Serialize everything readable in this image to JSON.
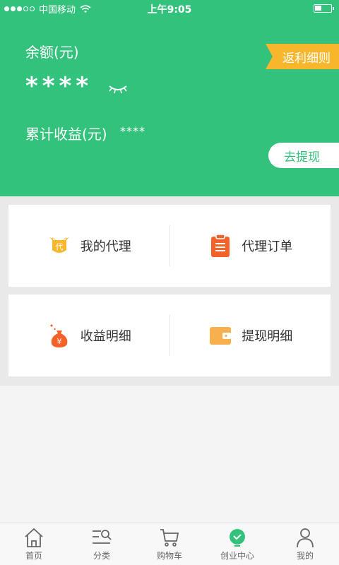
{
  "status_bar": {
    "carrier": "中国移动",
    "time": "上午9:05"
  },
  "header": {
    "balance_label": "余额(元)",
    "balance_value": "****",
    "income_label": "累计收益(元)",
    "income_value": "****",
    "rebate_tag": "返利细则",
    "withdraw_button": "去提现"
  },
  "menu": {
    "my_agent": "我的代理",
    "agent_orders": "代理订单",
    "income_detail": "收益明细",
    "withdraw_detail": "提现明细"
  },
  "tabs": [
    {
      "label": "首页",
      "icon": "home-icon"
    },
    {
      "label": "分类",
      "icon": "category-icon"
    },
    {
      "label": "购物车",
      "icon": "cart-icon"
    },
    {
      "label": "创业中心",
      "icon": "business-center-icon"
    },
    {
      "label": "我的",
      "icon": "profile-icon"
    }
  ],
  "colors": {
    "brand_green": "#33c27c",
    "tag_orange": "#f7b62c",
    "icon_orange": "#f4622a"
  }
}
